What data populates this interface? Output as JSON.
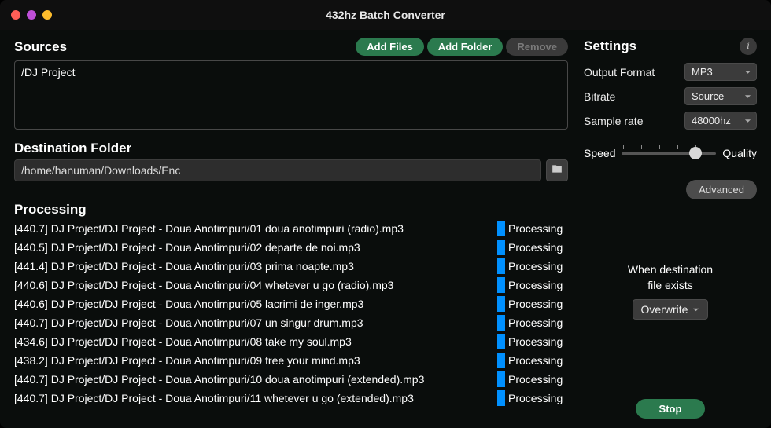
{
  "window": {
    "title": "432hz Batch Converter"
  },
  "sources": {
    "title": "Sources",
    "add_files": "Add Files",
    "add_folder": "Add Folder",
    "remove": "Remove",
    "items": [
      "/DJ Project"
    ]
  },
  "destination": {
    "title": "Destination Folder",
    "path": "/home/hanuman/Downloads/Enc"
  },
  "processing": {
    "title": "Processing",
    "status_label": "Processing",
    "rows": [
      {
        "name": "[440.7] DJ Project/DJ Project - Doua Anotimpuri/01 doua anotimpuri (radio).mp3"
      },
      {
        "name": "[440.5] DJ Project/DJ Project - Doua Anotimpuri/02 departe de noi.mp3"
      },
      {
        "name": "[441.4] DJ Project/DJ Project - Doua Anotimpuri/03 prima noapte.mp3"
      },
      {
        "name": "[440.6] DJ Project/DJ Project - Doua Anotimpuri/04 whetever u go (radio).mp3"
      },
      {
        "name": "[440.6] DJ Project/DJ Project - Doua Anotimpuri/05 lacrimi de inger.mp3"
      },
      {
        "name": "[440.7] DJ Project/DJ Project - Doua Anotimpuri/07 un singur drum.mp3"
      },
      {
        "name": "[434.6] DJ Project/DJ Project - Doua Anotimpuri/08 take my soul.mp3"
      },
      {
        "name": "[438.2] DJ Project/DJ Project - Doua Anotimpuri/09 free your mind.mp3"
      },
      {
        "name": "[440.7] DJ Project/DJ Project - Doua Anotimpuri/10 doua anotimpuri (extended).mp3"
      },
      {
        "name": "[440.7] DJ Project/DJ Project - Doua Anotimpuri/11 whetever u go (extended).mp3"
      }
    ]
  },
  "settings": {
    "title": "Settings",
    "output_format": {
      "label": "Output Format",
      "value": "MP3"
    },
    "bitrate": {
      "label": "Bitrate",
      "value": "Source"
    },
    "sample_rate": {
      "label": "Sample rate",
      "value": "48000hz"
    },
    "slider": {
      "left": "Speed",
      "right": "Quality",
      "pos_pct": 78
    },
    "advanced": "Advanced",
    "dest_exists": {
      "line1": "When destination",
      "line2": "file exists",
      "value": "Overwrite"
    },
    "stop": "Stop"
  }
}
